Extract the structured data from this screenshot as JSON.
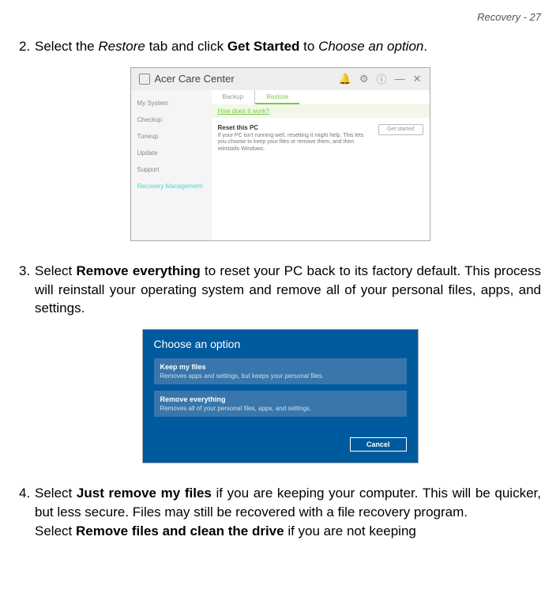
{
  "header": {
    "text": "Recovery - 27"
  },
  "step2": {
    "num": "2.",
    "line_a": "Select the ",
    "restore_tab": "Restore",
    "line_b": " tab and click ",
    "get_started": "Get Started",
    "line_c": " to ",
    "choose_option": "Choose an option",
    "line_d": "."
  },
  "acc": {
    "title": "Acer Care Center",
    "sidebar": {
      "items": [
        "My System",
        "Checkup",
        "Tuneup",
        "Update",
        "Support"
      ],
      "active": "Recovery Management"
    },
    "tabs": {
      "backup": "Backup",
      "restore": "Restore"
    },
    "link": "How does it work?",
    "reset": {
      "title": "Reset this PC",
      "desc": "If your PC isn't running well, resetting it might help. This lets you choose to keep your files or remove them, and then reinstalls Windows.",
      "button": "Get started"
    },
    "icons": {
      "bell": "🔔",
      "gear": "⚙",
      "info": "ⓘ",
      "min": "—",
      "close": "✕"
    }
  },
  "step3": {
    "num": "3.",
    "a": "Select ",
    "remove_everything": "Remove everything",
    "b": " to reset your PC back to its factory default. This process will reinstall your operating system and remove all of your personal files, apps, and settings."
  },
  "co": {
    "title": "Choose an option",
    "opt1": {
      "title": "Keep my files",
      "desc": "Removes apps and settings, but keeps your personal files."
    },
    "opt2": {
      "title": "Remove everything",
      "desc": "Removes all of your personal files, apps, and settings."
    },
    "cancel": "Cancel"
  },
  "step4": {
    "num": "4.",
    "a": "Select ",
    "just_remove": "Just remove my files",
    "b": " if you are keeping your computer. This will be quicker, but less secure. Files may still be recovered with a file recovery program.",
    "c": "Select ",
    "remove_clean": "Remove files and clean the drive",
    "d": " if you are not keeping"
  }
}
